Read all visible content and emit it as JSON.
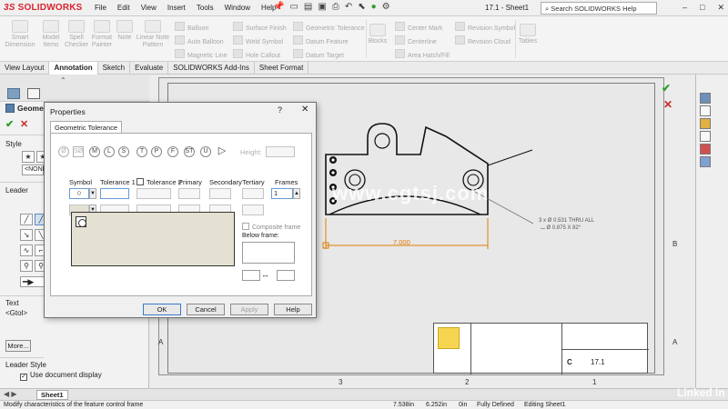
{
  "app": {
    "logo_prefix": "3S",
    "logo_text": "SOLIDWORKS",
    "menu": [
      "File",
      "Edit",
      "View",
      "Insert",
      "Tools",
      "Window",
      "Help"
    ],
    "doc_title": "17.1 - Sheet1",
    "search_placeholder": "Search SOLIDWORKS Help",
    "win_min": "–",
    "win_max": "□",
    "win_close": "✕"
  },
  "ribbon": {
    "smart_dimension": "Smart\nDimension",
    "model_items": "Model\nItems",
    "spell_checker": "Spell\nChecker",
    "format_painter": "Format\nPainter",
    "note": "Note",
    "linear_note_pattern": "Linear Note\nPattern",
    "balloon": "Balloon",
    "auto_balloon": "Auto Balloon",
    "magnetic_line": "Magnetic Line",
    "surface_finish": "Surface Finish",
    "weld_symbol": "Weld Symbol",
    "hole_callout": "Hole Callout",
    "geometric_tolerance": "Geometric Tolerance",
    "datum_feature": "Datum Feature",
    "datum_target": "Datum Target",
    "center_mark": "Center Mark",
    "centerline": "Centerline",
    "area_hatch": "Area Hatch/Fill",
    "revision_symbol": "Revision Symbol",
    "revision_cloud": "Revision Cloud",
    "blocks": "Blocks",
    "tables": "Tables"
  },
  "tabs": [
    "View Layout",
    "Annotation",
    "Sketch",
    "Evaluate",
    "SOLIDWORKS Add-Ins",
    "Sheet Format"
  ],
  "left_panel": {
    "title": "Geomet",
    "style_label": "Style",
    "style_value": "<NONE",
    "leader_label": "Leader",
    "text_label": "Text",
    "text_value": "<Gtol>",
    "more_button": "More...",
    "leader_style_label": "Leader Style",
    "use_document_display": "Use document display"
  },
  "dialog": {
    "title": "Properties",
    "help": "?",
    "close": "✕",
    "tab": "Geometric Tolerance",
    "height_label": "Height:",
    "columns": {
      "symbol": "Symbol",
      "tolerance1": "Tolerance 1",
      "tolerance2": "Tolerance 2",
      "primary": "Primary",
      "secondary": "Secondary",
      "tertiary": "Tertiary",
      "frames": "Frames"
    },
    "frames_value": "1",
    "composite_frame": "Composite frame",
    "below_frame": "Below frame:",
    "buttons": {
      "ok": "OK",
      "cancel": "Cancel",
      "apply": "Apply",
      "help": "Help"
    }
  },
  "drawing": {
    "dimension": "7.000",
    "hole_callout_line1": "3 x  Ø 0.531 THRU ALL",
    "hole_callout_line2": "⌴ Ø 0.875 X 82°",
    "zone_numbers": [
      "3",
      "2",
      "1"
    ],
    "zone_letters": [
      "B",
      "A"
    ],
    "title_block_size": "C",
    "title_block_dwg": "17.1"
  },
  "statusbar": {
    "message": "Modify characteristics of the feature control frame",
    "x": "7.538in",
    "y": "6.252in",
    "z": "0in",
    "state": "Fully Defined",
    "editing": "Editing Sheet1"
  },
  "sheet_tab": "Sheet1",
  "watermark": "www.cgtsj.com",
  "brand": "Linked in"
}
